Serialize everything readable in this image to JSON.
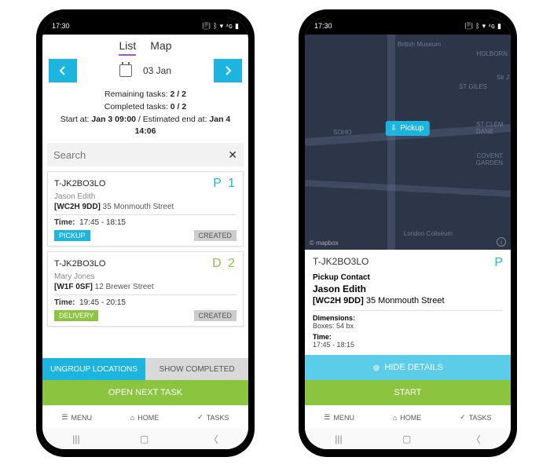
{
  "statusbar": {
    "time": "17:30"
  },
  "left": {
    "tabs": {
      "list": "List",
      "map": "Map"
    },
    "date": "03 Jan",
    "stats": {
      "remaining_label": "Remaining tasks:",
      "remaining": "2 / 2",
      "completed_label": "Completed tasks:",
      "completed": "0 / 2",
      "start_label": "Start at:",
      "start": "Jan 3 09:00",
      "est_label": "/ Estimated end at:",
      "est": "Jan 4 14:06"
    },
    "search": {
      "placeholder": "Search"
    },
    "cards": [
      {
        "code": "T-JK2BO3LO",
        "badge": "P 1",
        "name": "Jason Edith",
        "postcode": "[WC2H 9DD]",
        "street": "35 Monmouth Street",
        "time_label": "Time:",
        "time": "17:45 - 18:15",
        "type": "PICKUP",
        "status": "CREATED"
      },
      {
        "code": "T-JK2BO3LO",
        "badge": "D 2",
        "name": "Mary Jones",
        "postcode": "[W1F 0SF]",
        "street": "12 Brewer Street",
        "time_label": "Time:",
        "time": "19:45 - 20:15",
        "type": "DELIVERY",
        "status": "CREATED"
      }
    ],
    "buttons": {
      "ungroup": "UNGROUP LOCATIONS",
      "show_completed": "SHOW COMPLETED",
      "open_next": "OPEN NEXT TASK"
    }
  },
  "right": {
    "map": {
      "labels": {
        "top": "British Museum",
        "holborn": "HOLBORN",
        "stgiles": "ST GILES",
        "soho": "SOHO",
        "covent": "COVENT GARDEN",
        "stclem": "ST CLEM DANE",
        "coliseum": "London Coliseum",
        "sirj": "Sir J"
      },
      "pin": "Pickup",
      "attrib": "© mapbox"
    },
    "detail": {
      "code": "T-JK2BO3LO",
      "badge": "P",
      "contact_label": "Pickup Contact",
      "name": "Jason Edith",
      "postcode": "[WC2H 9DD]",
      "street": "35 Monmouth Street",
      "dim_label": "Dimensions:",
      "dim": "Boxes: 54 bx",
      "time_label": "Time:",
      "time": "17:45 - 18:15"
    },
    "buttons": {
      "hide": "HIDE DETAILS",
      "start": "START"
    }
  },
  "nav": {
    "menu": "MENU",
    "home": "HOME",
    "tasks": "TASKS"
  }
}
